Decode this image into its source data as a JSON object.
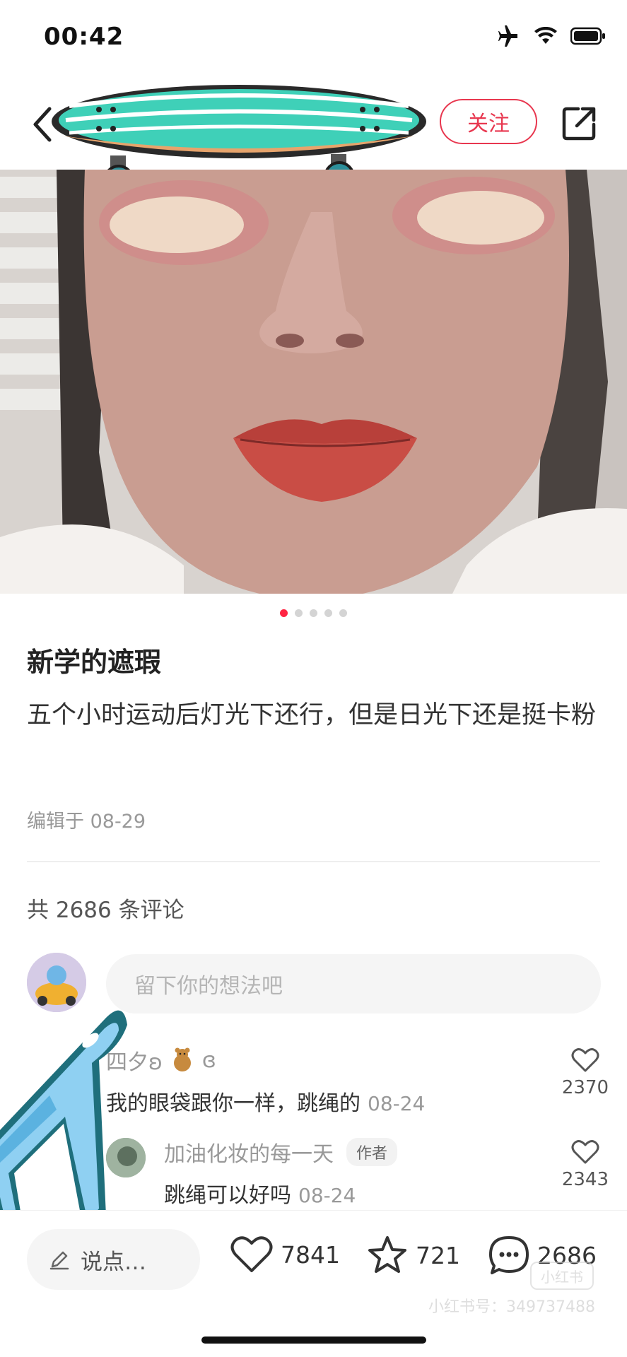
{
  "status_bar": {
    "time": "00:42"
  },
  "nav": {
    "follow_label": "关注"
  },
  "gallery": {
    "page_count": 5,
    "active_index": 0
  },
  "post": {
    "title": "新学的遮瑕",
    "body": "五个小时运动后灯光下还行，但是日光下还是挺卡粉",
    "edited": "编辑于 08-29"
  },
  "comments_header": "共 2686 条评论",
  "comment_input": {
    "placeholder": "留下你的想法吧"
  },
  "comments": [
    {
      "user": "四夕ʚ",
      "user_suffix": "ɞ",
      "text": "我的眼袋跟你一样，跳绳的",
      "date": "08-24",
      "likes": "2370"
    },
    {
      "user": "加油化妆的每一天",
      "tag": "作者",
      "text": "跳绳可以好吗",
      "date": "08-24",
      "likes": "2343"
    }
  ],
  "bottom_bar": {
    "say_label": "说点…",
    "like_count": "7841",
    "collect_count": "721",
    "comment_count": "2686",
    "watermark": "小红书号：349737488",
    "watermark_logo": "小红书"
  },
  "colors": {
    "accent": "#ff2442",
    "follow": "#e8374f"
  }
}
